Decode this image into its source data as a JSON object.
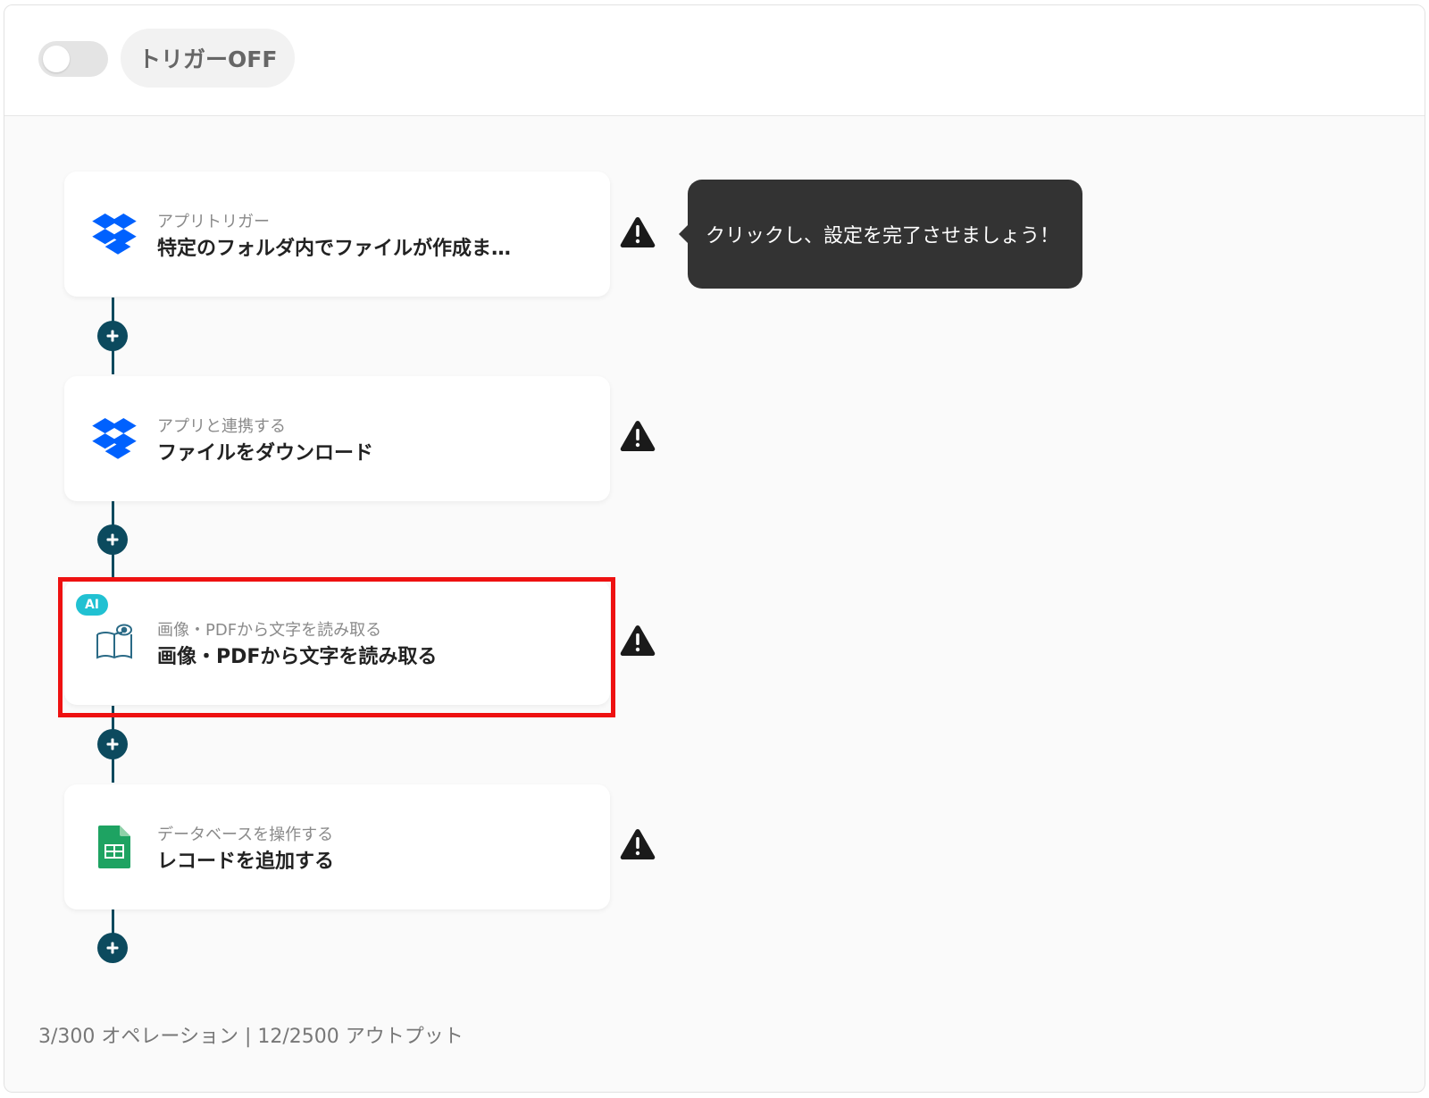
{
  "header": {
    "toggle_state": "off",
    "trigger_label": "トリガーOFF"
  },
  "tooltip": {
    "text": "クリックし、設定を完了させましょう！"
  },
  "steps": [
    {
      "icon": "dropbox-icon",
      "subtitle": "アプリトリガー",
      "title": "特定のフォルダ内でファイルが作成ま…",
      "has_warning": true
    },
    {
      "icon": "dropbox-icon",
      "subtitle": "アプリと連携する",
      "title": "ファイルをダウンロード",
      "has_warning": true
    },
    {
      "icon": "ocr-book-icon",
      "badge": "AI",
      "subtitle": "画像・PDFから文字を読み取る",
      "title": "画像・PDFから文字を読み取る",
      "has_warning": true,
      "highlighted": true
    },
    {
      "icon": "google-sheets-icon",
      "subtitle": "データベースを操作する",
      "title": "レコードを追加する",
      "has_warning": true
    }
  ],
  "footer": {
    "usage": "3/300 オペレーション | 12/2500 アウトプット"
  },
  "colors": {
    "accent": "#0c4a5e",
    "dropbox": "#0061fe",
    "sheets": "#1ea362",
    "ai_badge": "#21c1d2",
    "highlight": "#ee1111",
    "tooltip_bg": "#333333"
  }
}
